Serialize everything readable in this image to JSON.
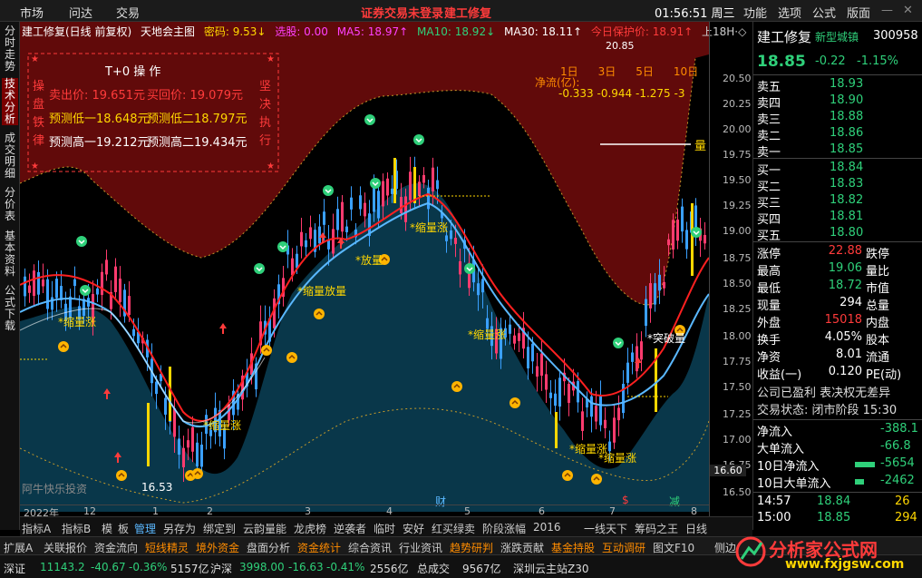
{
  "topbar": {
    "menus": [
      "市场",
      "问达",
      "交易"
    ],
    "warning": "证券交易未登录",
    "stock_title": "建工修复",
    "time": "01:56:51 周三",
    "right_menus": [
      "功能",
      "选项",
      "公式",
      "版面"
    ]
  },
  "chart_header": {
    "name": "建工修复(日线 前复权)",
    "formula": "天地会主图",
    "mima": "密码: 9.53↓",
    "xuangu": "选股: 0.00",
    "ma5": "MA5: 18.97↑",
    "ma10": "MA10: 18.92↓",
    "ma30": "MA30: 18.11↑",
    "baohu": "今日保护价: 18.91↑",
    "period": "上18H·◇"
  },
  "left_tabs": [
    "分时走势",
    "技术分析",
    "成交明细",
    "分价表",
    "基本资料",
    "公式下载"
  ],
  "t0": {
    "title": "T+0 操 作",
    "left_label": [
      "操",
      "盘",
      "铁",
      "律"
    ],
    "right_label": [
      "坚",
      "决",
      "执",
      "行"
    ],
    "sell": "卖出价: 19.651元",
    "buy": "买回价: 19.079元",
    "low1": "预测低一18.648元",
    "low2": "预测低二18.797元",
    "high1": "预测高一19.212元",
    "high2": "预测高二19.434元"
  },
  "netflow": {
    "label": "净流(亿):",
    "periods": [
      "1日",
      "3日",
      "5日",
      "10日"
    ],
    "values": "-0.333 -0.944 -1.275 -3"
  },
  "price_axis": [
    "20.85",
    "20.50",
    "20.25",
    "20.00",
    "19.75",
    "19.50",
    "19.25",
    "19.00",
    "18.75",
    "18.50",
    "18.25",
    "18.00",
    "17.75",
    "17.50",
    "17.25",
    "17.00",
    "16.75",
    "16.60",
    "16.50"
  ],
  "date_axis": [
    "2022年",
    "12",
    "1",
    "2",
    "3",
    "4",
    "5",
    "6",
    "7",
    "8"
  ],
  "annotations": {
    "liang": "量",
    "suoliang": "*缩量涨",
    "fangliang": "*放量",
    "suoliang_fangliang": "*缩量放量",
    "tuliang": "*突破量",
    "watermark": "阿牛快乐投资",
    "low_price": "16.53",
    "cai": "财",
    "s": "$",
    "jian": "减"
  },
  "quote": {
    "name": "建工修复",
    "sector": "新型城镇",
    "code": "300958",
    "price": "18.85",
    "change": "-0.22",
    "pct": "-1.15%",
    "sells": [
      [
        "卖五",
        "18.93"
      ],
      [
        "卖四",
        "18.90"
      ],
      [
        "卖三",
        "18.88"
      ],
      [
        "卖二",
        "18.86"
      ],
      [
        "卖一",
        "18.85"
      ]
    ],
    "buys": [
      [
        "买一",
        "18.84"
      ],
      [
        "买二",
        "18.83"
      ],
      [
        "买三",
        "18.82"
      ],
      [
        "买四",
        "18.81"
      ],
      [
        "买五",
        "18.80"
      ]
    ],
    "stats": [
      [
        "涨停",
        "22.88",
        "跌停",
        ""
      ],
      [
        "最高",
        "19.06",
        "量比",
        ""
      ],
      [
        "最低",
        "18.72",
        "市值",
        ""
      ],
      [
        "现量",
        "294",
        "总量",
        ""
      ],
      [
        "外盘",
        "15018",
        "内盘",
        ""
      ],
      [
        "换手",
        "4.05%",
        "股本",
        ""
      ],
      [
        "净资",
        "8.01",
        "流通",
        ""
      ],
      [
        "收益(一)",
        "0.120",
        "PE(动)",
        ""
      ]
    ],
    "notice": "公司已盈利 表决权无差异",
    "trade_state": "交易状态: 闭市阶段 15:30",
    "flows": [
      [
        "净流入",
        "-388.1"
      ],
      [
        "大单流入",
        "-66.8"
      ],
      [
        "10日净流入",
        "-5654"
      ],
      [
        "10日大单流入",
        "-2462"
      ]
    ],
    "ticks": [
      [
        "14:57",
        "18.84",
        "26"
      ],
      [
        "15:00",
        "18.85",
        "294"
      ]
    ]
  },
  "bottom_tabs": [
    "指标A",
    "指标B",
    "模",
    "板",
    "管理",
    "另存为",
    "绑定到",
    "云韵量能",
    "龙虎榜",
    "逆袭者",
    "临时",
    "安好",
    "红买绿卖",
    "阶段涨幅",
    "2016",
    "一线天下",
    "筹码之王",
    "日线"
  ],
  "nav": [
    "扩展A",
    "关联报价",
    "资金流向",
    "短线精灵",
    "境外资金",
    "盘面分析",
    "资金统计",
    "综合资讯",
    "行业资讯",
    "趋势研判",
    "涨跌贡献",
    "基金持股",
    "互动调研",
    "图文F10",
    "侧边"
  ],
  "status": {
    "sz": "深证",
    "sz_val": "11143.2",
    "sz_chg": "-40.67",
    "sz_pct": "-0.36%",
    "sz_amt": "5157亿",
    "hs": "沪深",
    "hs_val": "3998.00",
    "hs_chg": "-16.63",
    "hs_pct": "-0.41%",
    "hs_amt": "2556亿",
    "zcj": "总成交",
    "zcj_val": "9567亿",
    "site": "深圳云主站Z30"
  },
  "brand": {
    "cn": "分析家公式网",
    "url": "www.fxjgsw.com"
  },
  "colors": {
    "up": "#ff3b3b",
    "down": "#2fd07a",
    "yellow": "#ffd700",
    "cyan": "#00d8ff",
    "magenta": "#ff40ff",
    "band": "#7a0a0a",
    "band_low": "#08384d"
  }
}
